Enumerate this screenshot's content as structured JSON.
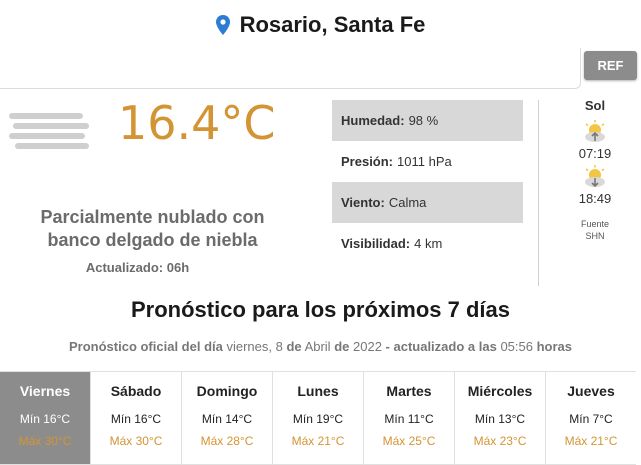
{
  "location": {
    "name": "Rosario, Santa Fe",
    "icon": "map-pin-icon"
  },
  "ref_button": "REF",
  "current": {
    "temperature": "16.4°C",
    "icon": "fog-icon",
    "description": "Parcialmente nublado con banco delgado de niebla",
    "updated": "Actualizado: 06h"
  },
  "stats": [
    {
      "label": "Humedad:",
      "value": "98 %"
    },
    {
      "label": "Presión:",
      "value": "1011 hPa"
    },
    {
      "label": "Viento:",
      "value": "Calma"
    },
    {
      "label": "Visibilidad:",
      "value": "4 km"
    }
  ],
  "sun": {
    "title": "Sol",
    "sunrise": "07:19",
    "sunset": "18:49",
    "source_line1": "Fuente",
    "source_line2": "SHN"
  },
  "forecast": {
    "title": "Pronóstico para los próximos 7 días",
    "subtitle_part1": "Pronóstico oficial del día",
    "subtitle_part2": "viernes, 8",
    "subtitle_part3": "de",
    "subtitle_part4": "Abril",
    "subtitle_part5": "de",
    "subtitle_part6": "2022",
    "subtitle_part7": "- actualizado a las",
    "subtitle_part8": "05:56",
    "subtitle_part9": "horas",
    "days": [
      {
        "name": "Viernes",
        "min": "Mín 16°C",
        "max": "Máx 30°C"
      },
      {
        "name": "Sábado",
        "min": "Mín 16°C",
        "max": "Máx 30°C"
      },
      {
        "name": "Domingo",
        "min": "Mín 14°C",
        "max": "Máx 28°C"
      },
      {
        "name": "Lunes",
        "min": "Mín 19°C",
        "max": "Máx 21°C"
      },
      {
        "name": "Martes",
        "min": "Mín 11°C",
        "max": "Máx 25°C"
      },
      {
        "name": "Miércoles",
        "min": "Mín 13°C",
        "max": "Máx 23°C"
      },
      {
        "name": "Jueves",
        "min": "Mín 7°C",
        "max": "Máx 21°C"
      }
    ]
  },
  "colors": {
    "accent": "#d39533",
    "active_day": "#8c8c8c",
    "pin": "#2b7cd3"
  }
}
